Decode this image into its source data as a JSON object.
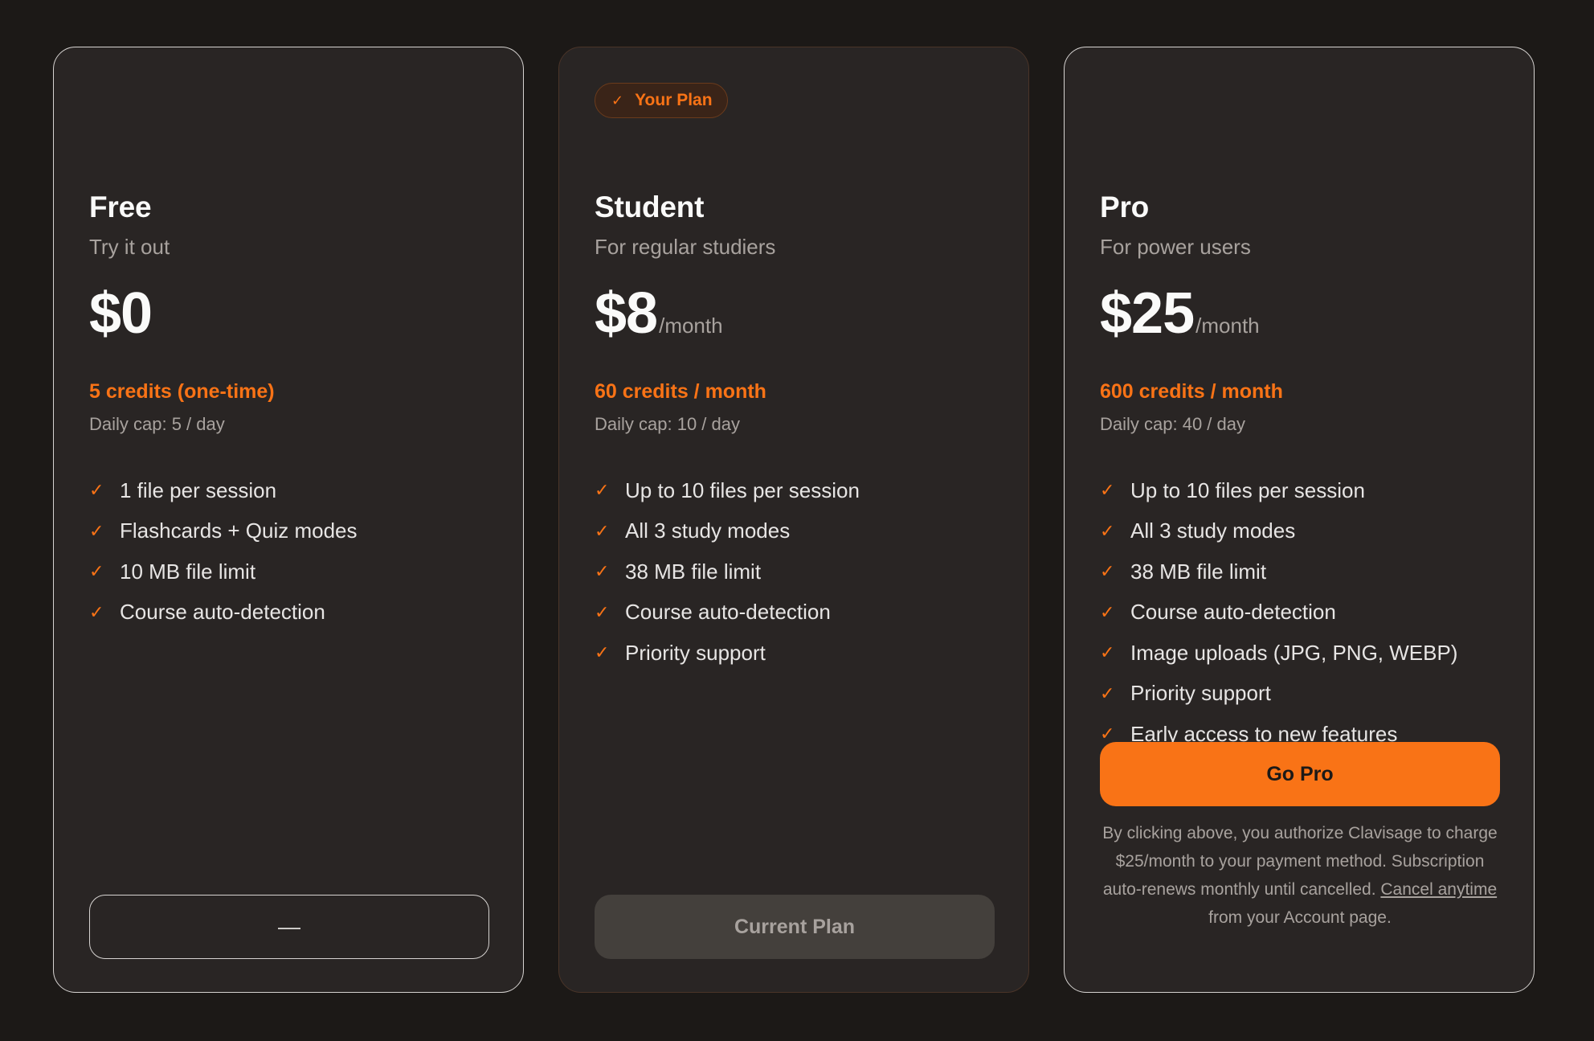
{
  "colors": {
    "background": "#1c1917",
    "card": "#292524",
    "accent": "#f97316",
    "muted_text": "#a8a29e"
  },
  "plans": [
    {
      "name": "Free",
      "tagline": "Try it out",
      "price": "$0",
      "period": "",
      "credits": "5 credits (one-time)",
      "cap": "Daily cap: 5 / day",
      "features": [
        "1 file per session",
        "Flashcards + Quiz modes",
        "10 MB file limit",
        "Course auto-detection"
      ],
      "button_label": "—"
    },
    {
      "badge": "Your Plan",
      "name": "Student",
      "tagline": "For regular studiers",
      "price": "$8",
      "period": "/month",
      "credits": "60 credits / month",
      "cap": "Daily cap: 10 / day",
      "features": [
        "Up to 10 files per session",
        "All 3 study modes",
        "38 MB file limit",
        "Course auto-detection",
        "Priority support"
      ],
      "button_label": "Current Plan"
    },
    {
      "name": "Pro",
      "tagline": "For power users",
      "price": "$25",
      "period": "/month",
      "credits": "600 credits / month",
      "cap": "Daily cap: 40 / day",
      "features": [
        "Up to 10 files per session",
        "All 3 study modes",
        "38 MB file limit",
        "Course auto-detection",
        "Image uploads (JPG, PNG, WEBP)",
        "Priority support",
        "Early access to new features"
      ],
      "button_label": "Go Pro",
      "disclaimer_before": "By clicking above, you authorize Clavisage to charge $25/month to your payment method. Subscription auto-renews monthly until cancelled. ",
      "disclaimer_link": "Cancel anytime",
      "disclaimer_after": " from your Account page."
    }
  ],
  "icons": {
    "check": "check-icon"
  }
}
